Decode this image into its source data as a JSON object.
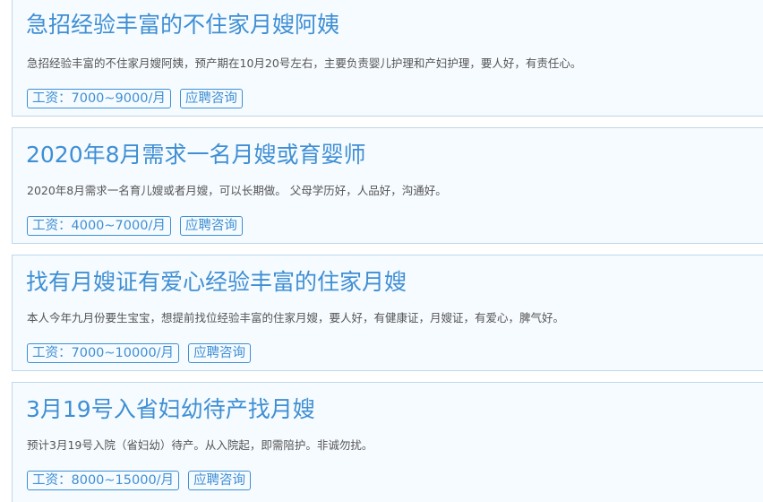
{
  "jobs": [
    {
      "title": "急招经验丰富的不住家月嫂阿姨",
      "description": "急招经验丰富的不住家月嫂阿姨，预产期在10月20号左右，主要负责婴儿护理和产妇护理，要人好，有责任心。",
      "salary": "工资：7000~9000/月",
      "apply_label": "应聘咨询"
    },
    {
      "title": "2020年8月需求一名月嫂或育婴师",
      "description": "2020年8月需求一名育儿嫂或者月嫂，可以长期做。 父母学历好，人品好，沟通好。",
      "salary": "工资：4000~7000/月",
      "apply_label": "应聘咨询"
    },
    {
      "title": "找有月嫂证有爱心经验丰富的住家月嫂",
      "description": "本人今年九月份要生宝宝，想提前找位经验丰富的住家月嫂，要人好，有健康证，月嫂证，有爱心，脾气好。",
      "salary": "工资：7000~10000/月",
      "apply_label": "应聘咨询"
    },
    {
      "title": "3月19号入省妇幼待产找月嫂",
      "description": "预计3月19号入院（省妇幼）待产。从入院起，即需陪护。非诚勿扰。",
      "salary": "工资：8000~15000/月",
      "apply_label": "应聘咨询"
    }
  ]
}
